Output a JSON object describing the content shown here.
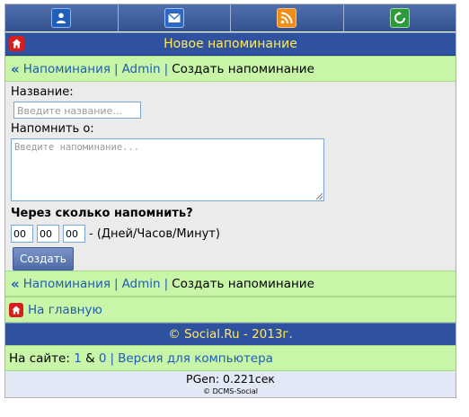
{
  "iconbar": {
    "items": [
      {
        "icon": "user-icon"
      },
      {
        "icon": "mail-icon"
      },
      {
        "icon": "rss-icon"
      },
      {
        "icon": "refresh-icon"
      }
    ]
  },
  "header": {
    "title": "Новое напоминание"
  },
  "breadcrumb": {
    "reminders": "Напоминания",
    "admin": "Admin",
    "current": "Создать напоминание",
    "separator": "|",
    "back_glyph": "«"
  },
  "form": {
    "name_label": "Название:",
    "name_placeholder": "Введите название...",
    "remind_label": "Напомнить о:",
    "remind_placeholder": "Введите напоминание...",
    "when_label": "Через сколько напомнить?",
    "days": "00",
    "hours": "00",
    "minutes": "00",
    "units_hint": "- (Дней/Часов/Минут)",
    "submit_label": "Создать"
  },
  "home_link": {
    "label": "На главную"
  },
  "footer": {
    "copyright": "© Social.Ru - 2013г."
  },
  "online": {
    "prefix": "На сайте:",
    "users": "1",
    "amp": "&",
    "guests": "0",
    "separator": "|",
    "desktop_link": "Версия для компьютера"
  },
  "pgen": "PGen: 0.221сек",
  "engine": "© DCMS-Social",
  "colors": {
    "accent_blue": "#2f52a0",
    "title_yellow": "#ffec55",
    "bar_green": "#c8f5a8",
    "link_blue": "#1f5cb8"
  }
}
